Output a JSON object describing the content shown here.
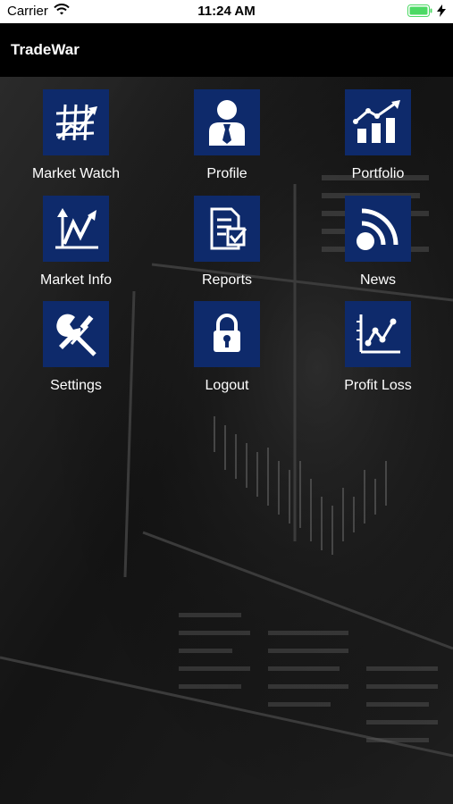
{
  "status_bar": {
    "carrier": "Carrier",
    "time": "11:24 AM",
    "battery_color": "#4cd964"
  },
  "nav": {
    "title": "TradeWar"
  },
  "colors": {
    "tile": "#0e2a6b",
    "nav_background": "#000000",
    "label": "#ffffff"
  },
  "menu": {
    "items": [
      {
        "label": "Market Watch",
        "icon": "chart-grid-icon"
      },
      {
        "label": "Profile",
        "icon": "user-icon"
      },
      {
        "label": "Portfolio",
        "icon": "bar-chart-trend-icon"
      },
      {
        "label": "Market Info",
        "icon": "line-chart-icon"
      },
      {
        "label": "Reports",
        "icon": "report-check-icon"
      },
      {
        "label": "News",
        "icon": "rss-icon"
      },
      {
        "label": "Settings",
        "icon": "wrench-screwdriver-icon"
      },
      {
        "label": "Logout",
        "icon": "lock-icon"
      },
      {
        "label": "Profit Loss",
        "icon": "scatter-line-icon"
      }
    ]
  }
}
